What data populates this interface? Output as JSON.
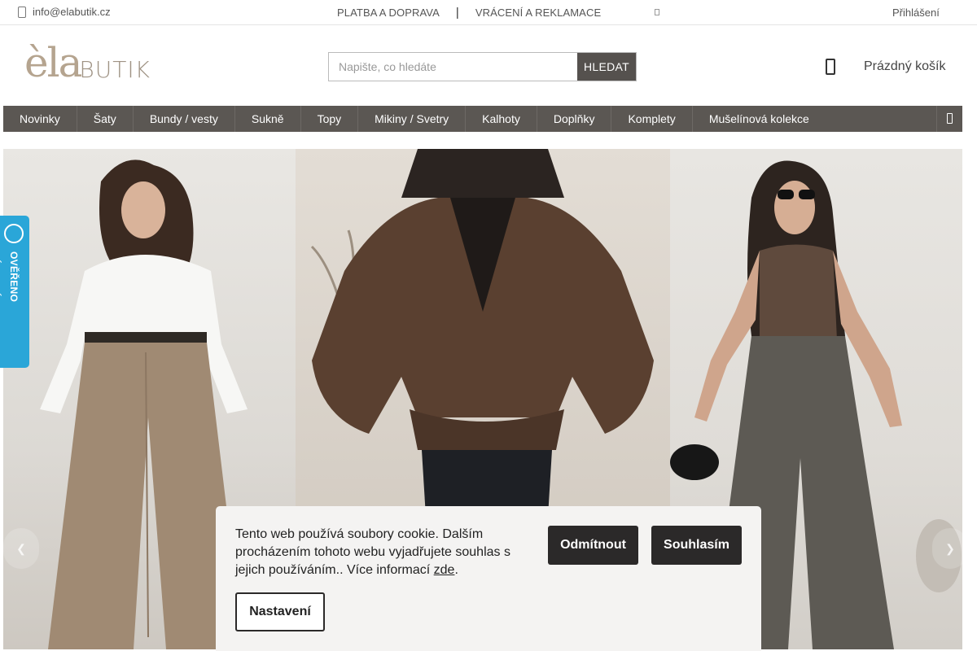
{
  "topbar": {
    "email": "info@elabutik.cz",
    "link_payment": "PLATBA A DOPRAVA",
    "separator": "|",
    "link_returns": "VRÁCENÍ A REKLAMACE",
    "login": "Přihlášení"
  },
  "logo": {
    "ela": "èla",
    "butik": "BUTIK"
  },
  "search": {
    "placeholder": "Napište, co hledáte",
    "button": "HLEDAT"
  },
  "cart": {
    "label": "Prázdný košík"
  },
  "nav": {
    "items": [
      "Novinky",
      "Šaty",
      "Bundy / vesty",
      "Sukně",
      "Topy",
      "Mikiny / Svetry",
      "Kalhoty",
      "Doplňky",
      "Komplety",
      "Mušelínová kolekce"
    ]
  },
  "badge": {
    "text": "OVĚŘENO ZÁKAZNÍKY"
  },
  "cookie": {
    "message": "Tento web používá soubory cookie. Dalším procházením tohoto webu vyjadřujete souhlas s jejich používáním.. Více informací ",
    "link": "zde",
    "period": ".",
    "decline": "Odmítnout",
    "accept": "Souhlasím",
    "settings": "Nastavení"
  },
  "icons": {
    "email": "phone-icon",
    "cart": "cart-icon",
    "menu": "menu-icon",
    "prev": "chevron-left-icon",
    "next": "chevron-right-icon"
  }
}
